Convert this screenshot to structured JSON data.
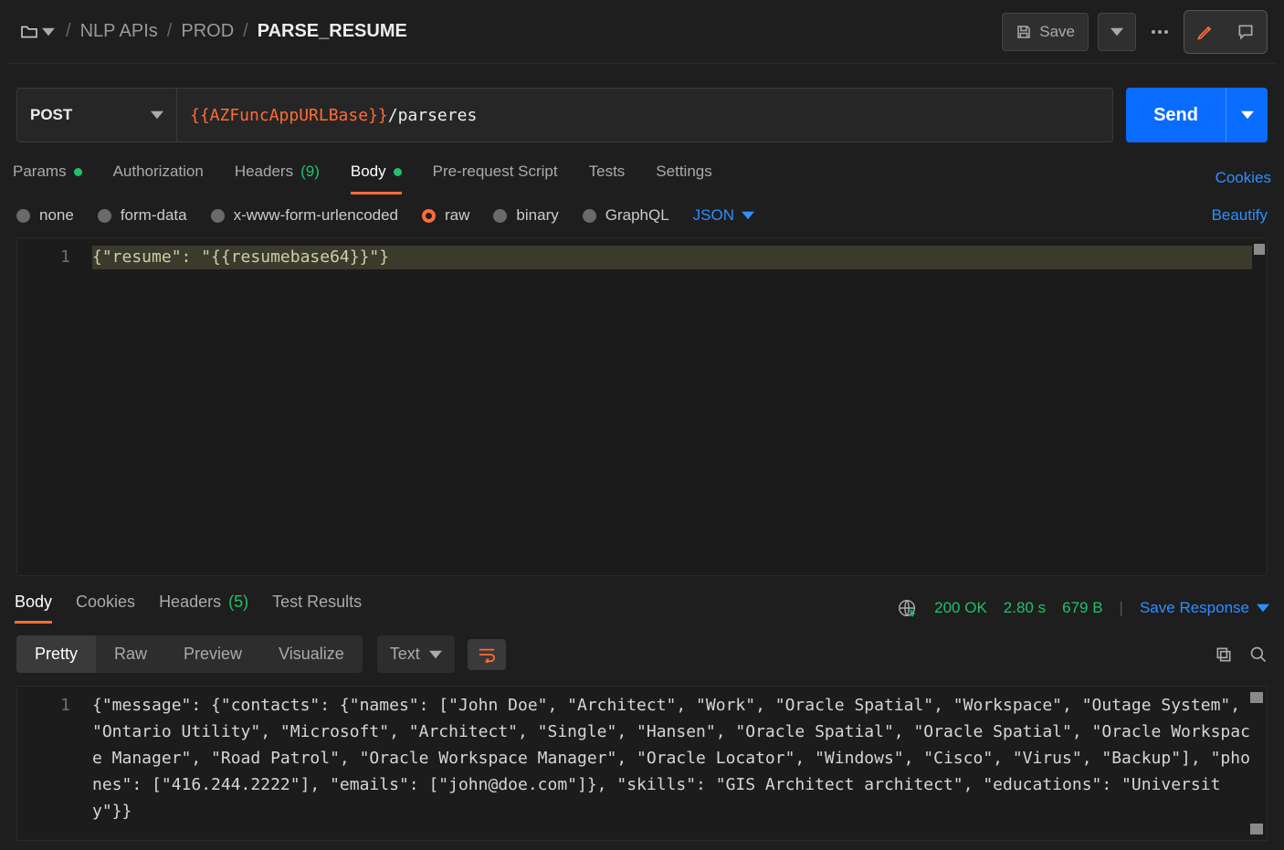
{
  "breadcrumb": {
    "collection": "NLP APIs",
    "folder": "PROD",
    "request": "PARSE_RESUME"
  },
  "header_buttons": {
    "save": "Save"
  },
  "request": {
    "method": "POST",
    "url_var": "{{AZFuncAppURLBase}}",
    "url_path": "/parseres",
    "send": "Send"
  },
  "req_tabs": {
    "params": "Params",
    "authorization": "Authorization",
    "headers": "Headers",
    "headers_count": "(9)",
    "body": "Body",
    "prerequest": "Pre-request Script",
    "tests": "Tests",
    "settings": "Settings",
    "cookies": "Cookies"
  },
  "body_types": {
    "none": "none",
    "formdata": "form-data",
    "urlencoded": "x-www-form-urlencoded",
    "raw": "raw",
    "binary": "binary",
    "graphql": "GraphQL",
    "content_type": "JSON",
    "beautify": "Beautify"
  },
  "request_body": {
    "line_no": "1",
    "text": "{\"resume\": \"{{resumebase64}}\"}"
  },
  "resp_tabs": {
    "body": "Body",
    "cookies": "Cookies",
    "headers": "Headers",
    "headers_count": "(5)",
    "test_results": "Test Results"
  },
  "resp_meta": {
    "status": "200 OK",
    "time": "2.80 s",
    "size": "679 B",
    "save": "Save Response"
  },
  "view_tabs": {
    "pretty": "Pretty",
    "raw": "Raw",
    "preview": "Preview",
    "visualize": "Visualize",
    "text": "Text"
  },
  "response_body": {
    "line_no": "1",
    "text": "{\"message\": {\"contacts\": {\"names\": [\"John Doe\", \"Architect\", \"Work\", \"Oracle Spatial\", \"Workspace\", \"Outage System\", \"Ontario Utility\", \"Microsoft\", \"Architect\", \"Single\", \"Hansen\", \"Oracle Spatial\", \"Oracle Spatial\", \"Oracle Workspace Manager\", \"Road Patrol\", \"Oracle Workspace Manager\", \"Oracle Locator\", \"Windows\", \"Cisco\", \"Virus\", \"Backup\"], \"phones\": [\"416.244.2222\"], \"emails\": [\"john@doe.com\"]}, \"skills\": \"GIS Architect architect\", \"educations\": \"University\"}}"
  }
}
